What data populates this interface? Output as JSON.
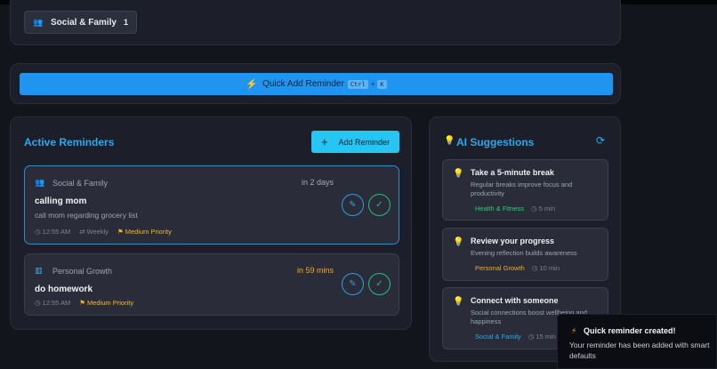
{
  "categories": {
    "chip": {
      "icon": "people-icon",
      "label": "Social & Family",
      "count": "1"
    }
  },
  "quick_add": {
    "label": "Quick Add Reminder",
    "shortcut_key1": "Ctrl",
    "shortcut_plus": "+",
    "shortcut_key2": "K"
  },
  "reminders": {
    "title": "Active Reminders",
    "add_button": "Add Reminder",
    "items": [
      {
        "category": "Social & Family",
        "category_icon": "people-icon",
        "when": "in 2 days",
        "title": "calling mom",
        "description": "call mom regarding grocery list",
        "time": "12:55 AM",
        "repeat": "Weekly",
        "priority": "Medium Priority"
      },
      {
        "category": "Personal Growth",
        "category_icon": "books-icon",
        "when": "in 59 mins",
        "title": "do homework",
        "time": "12:55 AM",
        "priority": "Medium Priority"
      }
    ]
  },
  "ai": {
    "title": "AI Suggestions",
    "suggestions": [
      {
        "title": "Take a 5-minute break",
        "description": "Regular breaks improve focus and productivity",
        "tag": "Health & Fitness",
        "tag_color": "#2ecc71",
        "duration": "5 min"
      },
      {
        "title": "Review your progress",
        "description": "Evening reflection builds awareness",
        "tag": "Personal Growth",
        "tag_color": "#f2a825",
        "duration": "10 min"
      },
      {
        "title": "Connect with someone",
        "description": "Social connections boost wellbeing and happiness",
        "tag": "Social & Family",
        "tag_color": "#2aa8ee",
        "duration": "15 min"
      }
    ]
  },
  "toast": {
    "title": "Quick reminder created!",
    "message": "Your reminder has been added with smart defaults"
  },
  "colors": {
    "accent": "#1f95f0",
    "priority": "#f2b62b",
    "success": "#23c07a"
  }
}
